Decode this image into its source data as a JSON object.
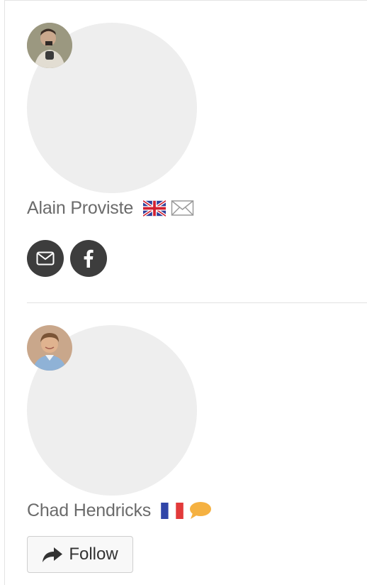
{
  "profiles": [
    {
      "name": "Alain Proviste",
      "flag": "uk-flag-icon",
      "contact_icon": "envelope-icon",
      "social_buttons": [
        {
          "icon": "envelope-icon",
          "label": "email"
        },
        {
          "icon": "facebook-icon",
          "label": "facebook"
        }
      ]
    },
    {
      "name": "Chad Hendricks",
      "flag": "france-flag-icon",
      "contact_icon": "speech-bubble-icon",
      "follow_label": "Follow"
    }
  ],
  "colors": {
    "name_text": "#6b6b6b",
    "photo_placeholder": "#eeeeee",
    "social_button_bg": "#3d3d3d",
    "chat_bubble": "#f5b141",
    "follow_button_border": "#cfcfcf"
  }
}
